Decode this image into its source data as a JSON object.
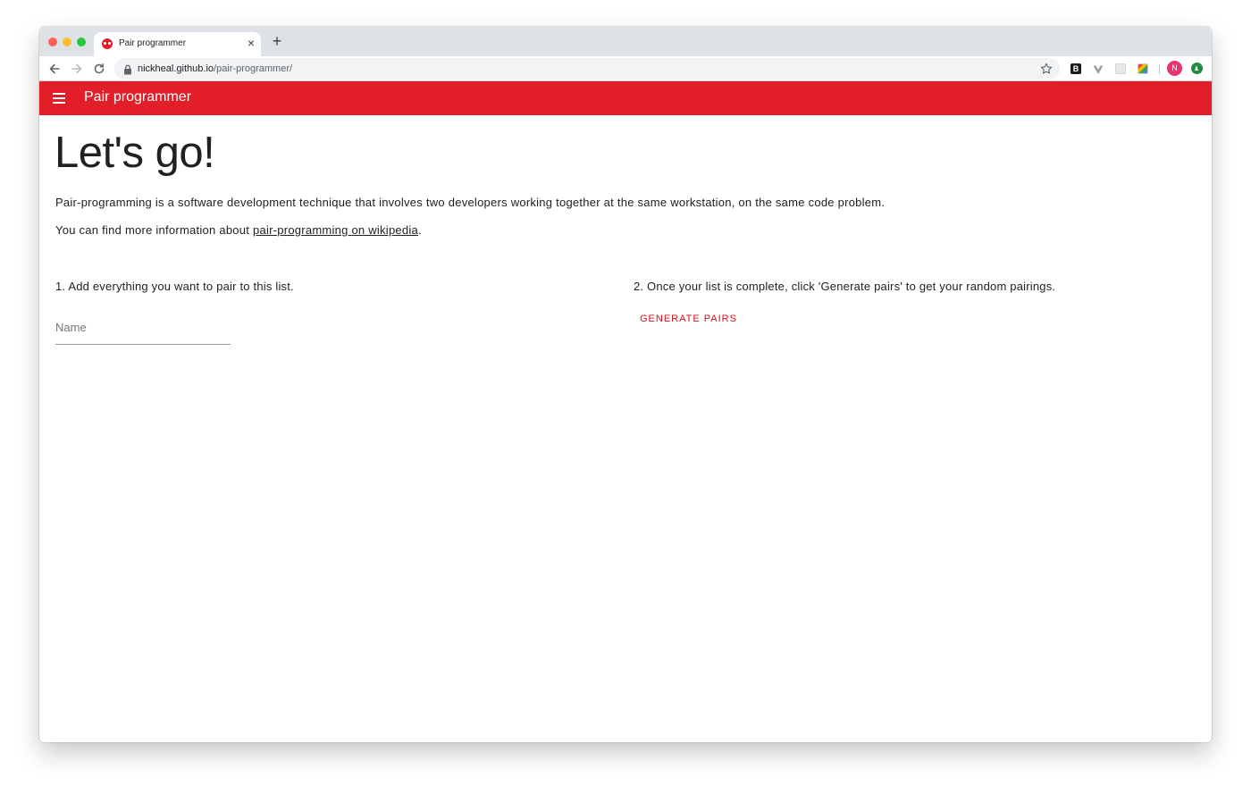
{
  "browser": {
    "tab": {
      "title": "Pair programmer",
      "close_glyph": "×",
      "favicon": "pair-programmer-favicon"
    },
    "new_tab_glyph": "+",
    "address": {
      "host": "nickheal.github.io",
      "path": "/pair-programmer/"
    },
    "extensions": {
      "b_label": "B",
      "avatar_initial": "N"
    }
  },
  "app_bar": {
    "title": "Pair programmer",
    "color": "#e21e29"
  },
  "page": {
    "heading": "Let's go!",
    "intro": "Pair-programming is a software development technique that involves two developers working together at the same workstation, on the same code problem.",
    "more_info_prefix": "You can find more information about ",
    "more_info_link": "pair-programming on wikipedia",
    "more_info_suffix": "."
  },
  "step1": {
    "text": "1. Add everything you want to pair to this list.",
    "name_placeholder": "Name"
  },
  "step2": {
    "text": "2. Once your list is complete, click 'Generate pairs' to get your random pairings.",
    "button_label": "GENERATE PAIRS",
    "button_color": "#d50f1c"
  }
}
